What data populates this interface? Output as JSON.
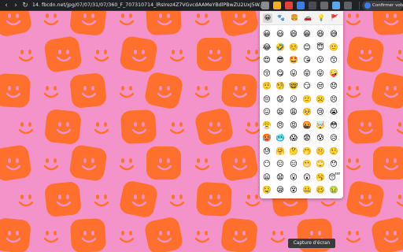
{
  "browser": {
    "url": "14. fbcdn.net/jpg/07/07/31/07/360_F_707310714_lRsIrez4Z7VGvcdAAMeYBdlPBwZU2UxJ5W.jpg",
    "profile_button_label": "Confirmer votre",
    "icons": [
      "back-icon",
      "forward-icon",
      "reload-icon"
    ],
    "extensions": [
      {
        "name": "puzzle-extension-icon",
        "color": "#8a8c90"
      },
      {
        "name": "shield-extension-icon",
        "color": "#f2b01e"
      },
      {
        "name": "red-extension-icon",
        "color": "#e0413a"
      },
      {
        "name": "blue-extension-icon",
        "color": "#3d7de6"
      },
      {
        "name": "dark-extension-icon",
        "color": "#4b4c51"
      },
      {
        "name": "grey-extension-icon",
        "color": "#6a6b70"
      },
      {
        "name": "sky-extension-icon",
        "color": "#5aa6f0"
      },
      {
        "name": "menu-extension-icon",
        "color": "#5f6166"
      }
    ]
  },
  "wallpaper": {
    "colors": {
      "pink": "#f493c9",
      "orange": "#ff6f2e"
    }
  },
  "emoji_picker": {
    "tabs": [
      "😀",
      "🐾",
      "🍔",
      "🚗",
      "💡",
      "🚩"
    ],
    "active_tab": 0,
    "rows": [
      [
        "😀",
        "😃",
        "😄",
        "😁",
        "😆",
        "😅"
      ],
      [
        "😂",
        "🤣",
        "☺️",
        "😊",
        "😇",
        "🙂"
      ],
      [
        "😍",
        "😎",
        "🤩",
        "😘",
        "😗",
        "😙"
      ],
      [
        "😚",
        "😋",
        "😛",
        "😝",
        "😜",
        "🤪"
      ],
      [
        "🤨",
        "🧐",
        "🤓",
        "😏",
        "😒",
        "😞"
      ],
      [
        "😔",
        "😟",
        "😕",
        "🙁",
        "☹️",
        "😣"
      ],
      [
        "😖",
        "😫",
        "😩",
        "🥺",
        "😢",
        "😭"
      ],
      [
        "😤",
        "😠",
        "😡",
        "🤬",
        "🤯",
        "😳"
      ],
      [
        "🥵",
        "🥶",
        "😱",
        "😨",
        "😰",
        "😥"
      ],
      [
        "😓",
        "🤗",
        "🤔",
        "🤭",
        "🤫",
        "🤥"
      ],
      [
        "😶",
        "😐",
        "😑",
        "😬",
        "🙄",
        "😯"
      ],
      [
        "😦",
        "😧",
        "😮",
        "😲",
        "🥱",
        "😴"
      ],
      [
        "🤤",
        "😪",
        "😵",
        "🤐",
        "🥴",
        "🤢"
      ]
    ]
  },
  "tooltip": {
    "label": "Capture d'écran"
  }
}
